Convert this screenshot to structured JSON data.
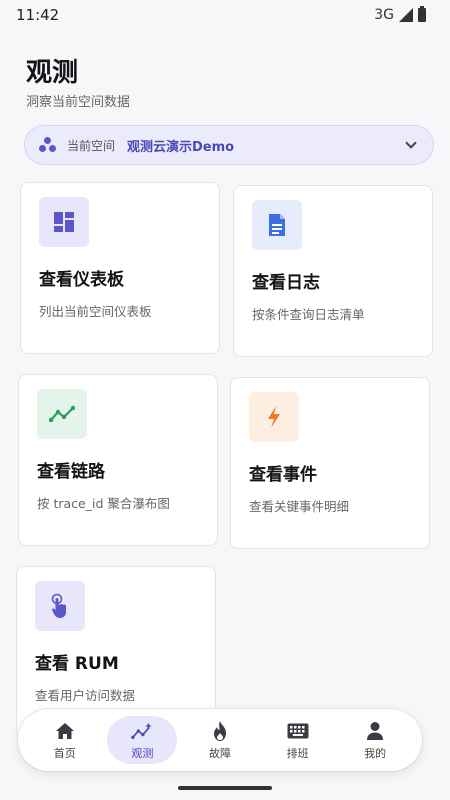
{
  "status_bar": {
    "time": "11:42",
    "network": "3G"
  },
  "header": {
    "title": "观测",
    "subtitle": "洞察当前空间数据"
  },
  "space": {
    "label": "当前空间",
    "value": "观测云演示Demo"
  },
  "cards": [
    {
      "title": "查看仪表板",
      "desc": "列出当前空间仪表板",
      "icon": "dashboard-icon",
      "color": "#5b57c9"
    },
    {
      "title": "查看日志",
      "desc": "按条件查询日志清单",
      "icon": "document-icon",
      "color": "#3d6fe0"
    },
    {
      "title": "查看链路",
      "desc": "按 trace_id 聚合瀑布图",
      "icon": "trace-icon",
      "color": "#2f9c5a"
    },
    {
      "title": "查看事件",
      "desc": "查看关键事件明细",
      "icon": "lightning-icon",
      "color": "#ef7a2a"
    },
    {
      "title": "查看 RUM",
      "desc": "查看用户访问数据",
      "icon": "touch-icon",
      "color": "#5b57c9"
    }
  ],
  "nav": [
    {
      "label": "首页",
      "icon": "home-icon"
    },
    {
      "label": "观测",
      "icon": "sparkline-icon",
      "active": true
    },
    {
      "label": "故障",
      "icon": "fire-icon"
    },
    {
      "label": "排班",
      "icon": "keyboard-icon"
    },
    {
      "label": "我的",
      "icon": "person-icon"
    }
  ],
  "colors": {
    "accent": "#4b47b8",
    "accent_bg": "#e8e6fa"
  }
}
